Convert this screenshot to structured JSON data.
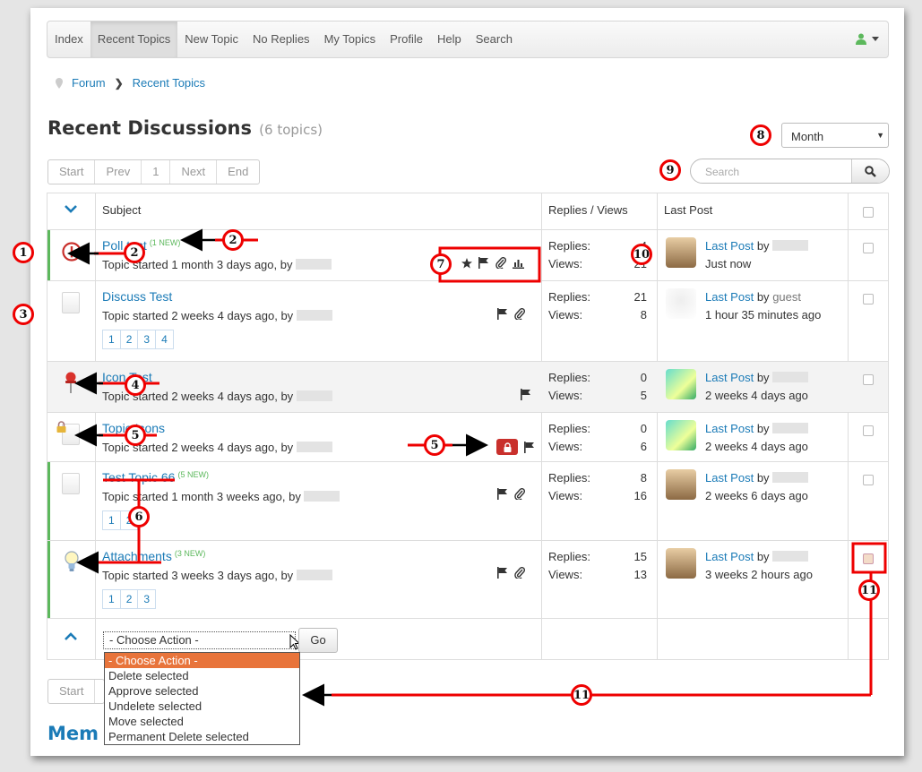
{
  "nav": {
    "items": [
      "Index",
      "Recent Topics",
      "New Topic",
      "No Replies",
      "My Topics",
      "Profile",
      "Help",
      "Search"
    ]
  },
  "breadcrumb": {
    "items": [
      "Forum",
      "Recent Topics"
    ]
  },
  "header": {
    "title": "Recent Discussions",
    "count": "(6 topics)"
  },
  "filter": {
    "selected": "Month"
  },
  "pager": {
    "start": "Start",
    "prev": "Prev",
    "page": "1",
    "next": "Next",
    "end": "End"
  },
  "search": {
    "placeholder": "Search"
  },
  "table": {
    "col_subject": "Subject",
    "col_rv": "Replies / Views",
    "col_last": "Last Post"
  },
  "labels": {
    "replies": "Replies:",
    "views": "Views:",
    "last_post": "Last Post",
    "by": "by"
  },
  "topics": [
    {
      "title": "Poll test",
      "new_badge": "(1 NEW)",
      "meta": "Topic started 1 month 3 days ago, by",
      "replies": "4",
      "views": "21",
      "last_time": "Just now",
      "last_user": ""
    },
    {
      "title": "Discuss Test",
      "new_badge": "",
      "meta": "Topic started 2 weeks 4 days ago, by",
      "replies": "21",
      "views": "8",
      "last_time": "1 hour 35 minutes ago",
      "last_user": "guest",
      "pages": [
        "1",
        "2",
        "3",
        "4"
      ]
    },
    {
      "title": "Icon Test",
      "new_badge": "",
      "meta": "Topic started 2 weeks 4 days ago, by",
      "replies": "0",
      "views": "5",
      "last_time": "2 weeks 4 days ago",
      "last_user": ""
    },
    {
      "title": "Topic Icons",
      "new_badge": "",
      "meta": "Topic started 2 weeks 4 days ago, by",
      "replies": "0",
      "views": "6",
      "last_time": "2 weeks 4 days ago",
      "last_user": ""
    },
    {
      "title": "Test Topic 66",
      "new_badge": "(5 NEW)",
      "meta": "Topic started 1 month 3 weeks ago, by",
      "replies": "8",
      "views": "16",
      "last_time": "2 weeks 6 days ago",
      "last_user": "",
      "pages": [
        "1",
        "2"
      ]
    },
    {
      "title": "Attachments",
      "new_badge": "(3 NEW)",
      "meta": "Topic started 3 weeks 3 days ago, by",
      "replies": "15",
      "views": "13",
      "last_time": "3 weeks 2 hours ago",
      "last_user": "",
      "pages": [
        "1",
        "2",
        "3"
      ]
    }
  ],
  "actions": {
    "selected": "- Choose Action -",
    "go": "Go",
    "options": [
      "- Choose Action -",
      "Delete selected",
      "Approve selected",
      "Undelete selected",
      "Move selected",
      "Permanent Delete selected"
    ]
  },
  "bottom": {
    "start": "Start",
    "members": "Mem"
  },
  "annotations": [
    "1",
    "2",
    "2",
    "3",
    "4",
    "5",
    "5",
    "6",
    "7",
    "8",
    "9",
    "10",
    "11",
    "11"
  ],
  "colors": {
    "link": "#1b7bb7",
    "new_bar": "#5cb85c",
    "annotation": "#e00000",
    "selected_option": "#e8743b"
  }
}
